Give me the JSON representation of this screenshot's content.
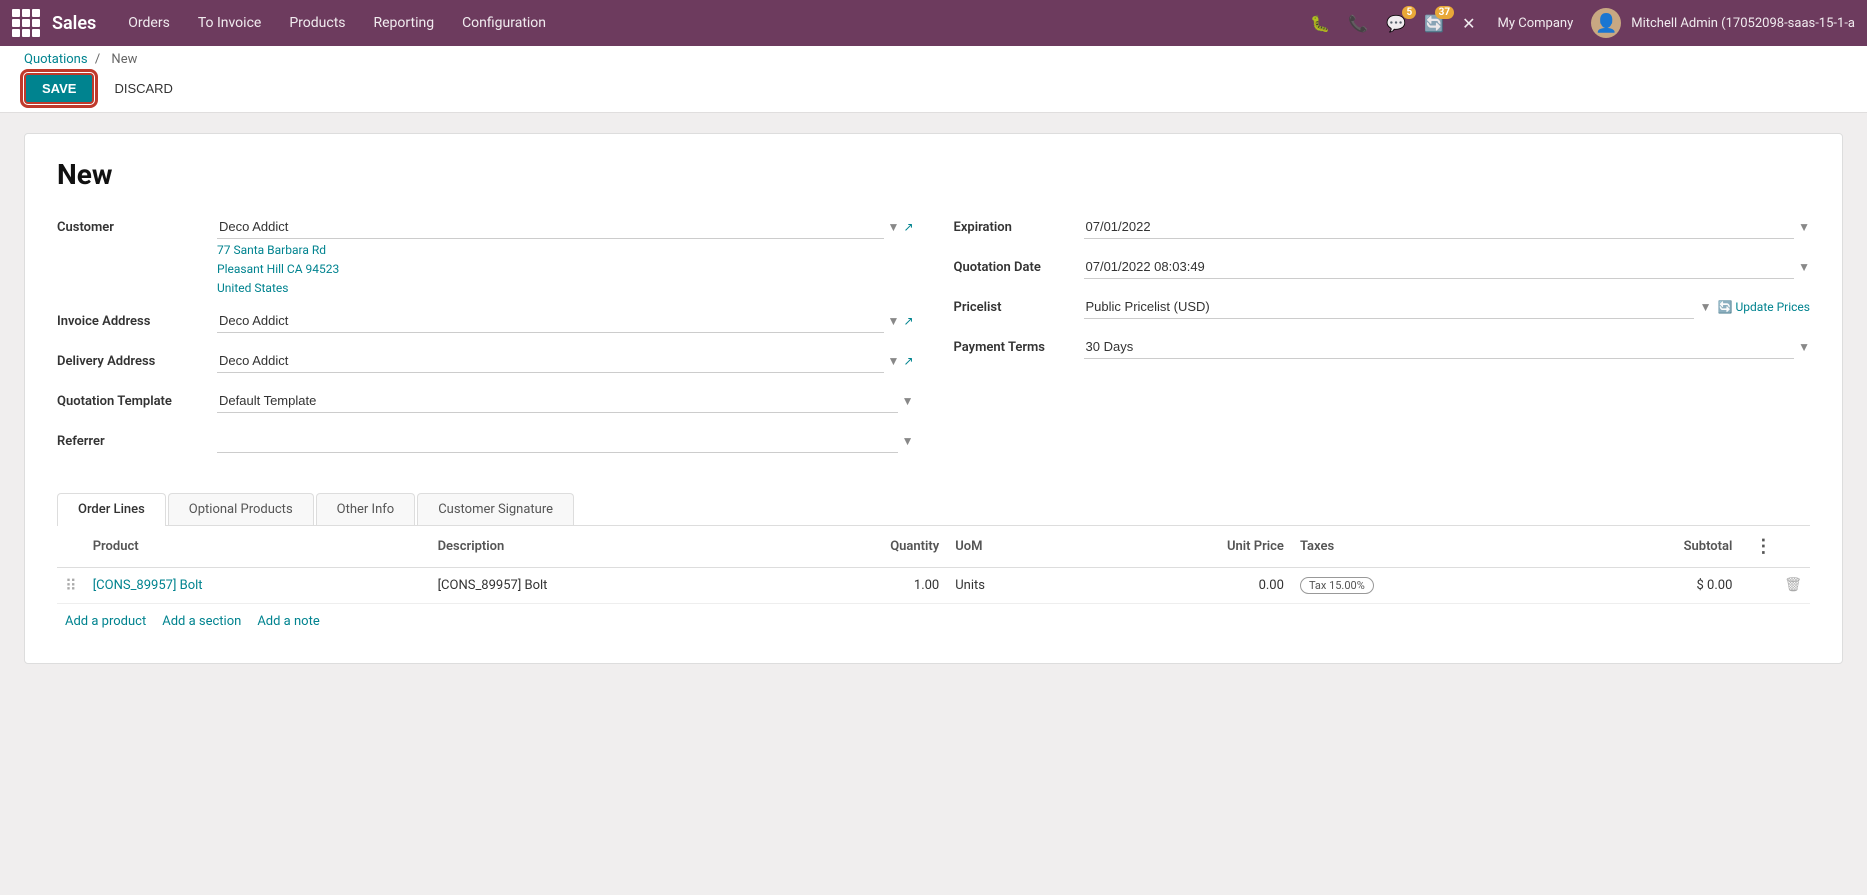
{
  "app": {
    "name": "Sales",
    "nav_items": [
      "Orders",
      "To Invoice",
      "Products",
      "Reporting",
      "Configuration"
    ]
  },
  "topbar": {
    "bug_icon": "🐛",
    "phone_icon": "📞",
    "chat_label": "5",
    "refresh_label": "37",
    "settings_icon": "✕",
    "company": "My Company",
    "user": "Mitchell Admin (17052098-saas-15-1-a"
  },
  "breadcrumb": {
    "parent": "Quotations",
    "separator": "/",
    "current": "New"
  },
  "toolbar": {
    "save_label": "SAVE",
    "discard_label": "DISCARD"
  },
  "form": {
    "title": "New",
    "left": {
      "customer_label": "Customer",
      "customer_value": "Deco Addict",
      "customer_address_line1": "77 Santa Barbara Rd",
      "customer_address_line2": "Pleasant Hill CA 94523",
      "customer_address_line3": "United States",
      "invoice_address_label": "Invoice Address",
      "invoice_address_value": "Deco Addict",
      "delivery_address_label": "Delivery Address",
      "delivery_address_value": "Deco Addict",
      "quotation_template_label": "Quotation Template",
      "quotation_template_value": "Default Template",
      "referrer_label": "Referrer",
      "referrer_value": ""
    },
    "right": {
      "expiration_label": "Expiration",
      "expiration_value": "07/01/2022",
      "quotation_date_label": "Quotation Date",
      "quotation_date_value": "07/01/2022 08:03:49",
      "pricelist_label": "Pricelist",
      "pricelist_value": "Public Pricelist (USD)",
      "update_prices_label": "Update Prices",
      "payment_terms_label": "Payment Terms",
      "payment_terms_value": "30 Days"
    }
  },
  "tabs": [
    {
      "id": "order-lines",
      "label": "Order Lines",
      "active": true
    },
    {
      "id": "optional-products",
      "label": "Optional Products",
      "active": false
    },
    {
      "id": "other-info",
      "label": "Other Info",
      "active": false
    },
    {
      "id": "customer-signature",
      "label": "Customer Signature",
      "active": false
    }
  ],
  "table": {
    "columns": [
      {
        "id": "drag",
        "label": ""
      },
      {
        "id": "product",
        "label": "Product"
      },
      {
        "id": "description",
        "label": "Description"
      },
      {
        "id": "quantity",
        "label": "Quantity"
      },
      {
        "id": "uom",
        "label": "UoM"
      },
      {
        "id": "unit_price",
        "label": "Unit Price"
      },
      {
        "id": "taxes",
        "label": "Taxes"
      },
      {
        "id": "subtotal",
        "label": "Subtotal"
      },
      {
        "id": "actions",
        "label": "⋮"
      }
    ],
    "rows": [
      {
        "product": "[CONS_89957] Bolt",
        "description": "[CONS_89957] Bolt",
        "quantity": "1.00",
        "uom": "Units",
        "unit_price": "0.00",
        "tax": "Tax 15.00%",
        "subtotal": "$ 0.00"
      }
    ],
    "add_actions": [
      {
        "id": "add-product",
        "label": "Add a product"
      },
      {
        "id": "add-section",
        "label": "Add a section"
      },
      {
        "id": "add-note",
        "label": "Add a note"
      }
    ]
  }
}
